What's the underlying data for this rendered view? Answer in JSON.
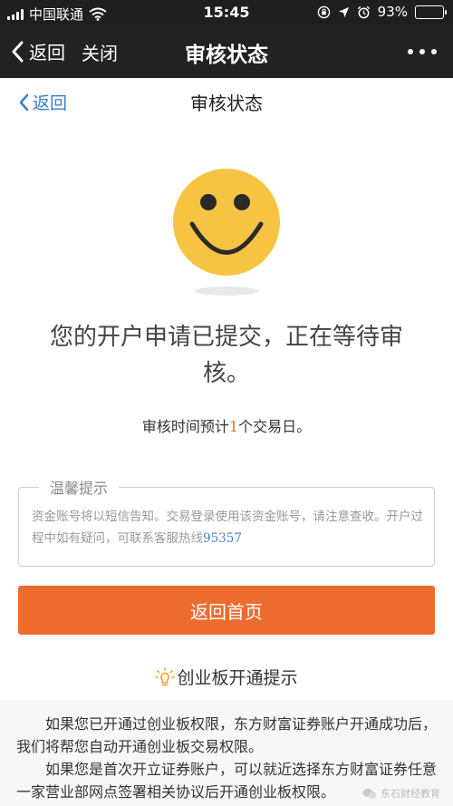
{
  "status_bar": {
    "carrier": "中国联通",
    "time": "15:45",
    "battery_percent_text": "93%",
    "battery_level": 0.93,
    "battery_color": "#4cd964"
  },
  "nav_bar": {
    "back_label": "返回",
    "close_label": "关闭",
    "title": "审核状态"
  },
  "page_header": {
    "back_label": "返回",
    "title": "审核状态"
  },
  "status": {
    "headline": "您的开户申请已提交，正在等待审核。",
    "eta_prefix": "审核时间预计",
    "eta_days": "1",
    "eta_suffix": "个交易日。"
  },
  "tips": {
    "legend": "温馨提示",
    "text": "资金账号将以短信告知。交易登录使用该资金账号，请注意查收。开户过程中如有疑问，可联系客服热线",
    "hotline": "95357"
  },
  "home_button": {
    "label": "返回首页",
    "color": "#ee6b2f"
  },
  "gem_notice": {
    "title": "创业板开通提示",
    "paragraph1": "如果您已开通过创业板权限，东方财富证券账户开通成功后，我们将帮您自动开通创业板交易权限。",
    "paragraph2": "如果您是首次开立证券账户，可以就近选择东方财富证券任意一家营业部网点签署相关协议后开通创业板权限。"
  },
  "watermark": {
    "text": "东石财经教育"
  },
  "colors": {
    "accent_orange": "#ee6b2f",
    "link_blue": "#3a7bd5",
    "smiley_yellow": "#f6c343"
  },
  "icons": {
    "back": "chevron-left-icon",
    "wifi": "wifi-icon",
    "more": "more-dots-icon",
    "smiley": "smiley-face-icon",
    "bulb": "lightbulb-icon"
  }
}
